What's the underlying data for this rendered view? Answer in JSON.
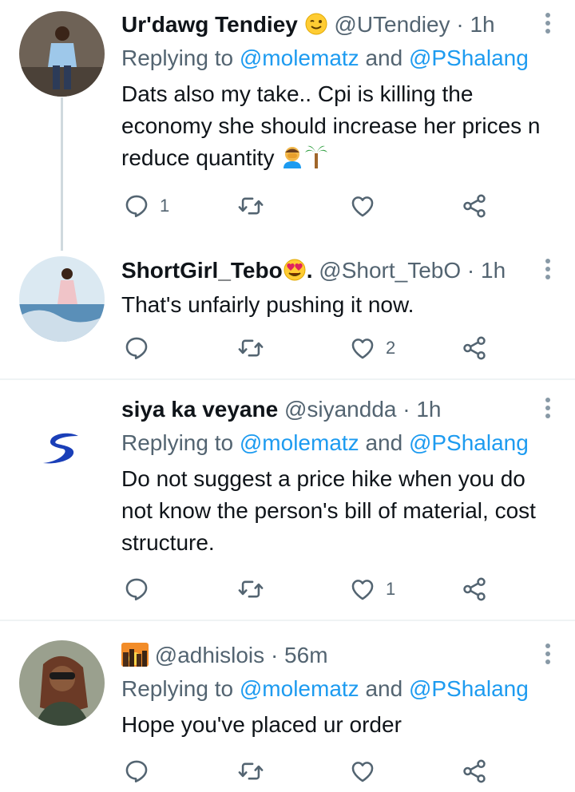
{
  "tweets": [
    {
      "name": "Ur'dawg Tendiey",
      "handle": "@UTendiey",
      "time": "1h",
      "replying_prefix": "Replying to",
      "replying_users": [
        "@molematz",
        "@PShalang"
      ],
      "replying_joiner": "and",
      "text": "Dats also my take.. Cpi is killing the economy she should increase her prices n reduce quantity",
      "emojis": [
        "facepalm-emoji",
        "palm-tree-emoji"
      ],
      "reply_count": "1",
      "retweet_count": "",
      "like_count": ""
    },
    {
      "name": "ShortGirl_Tebo",
      "name_suffix": ".",
      "handle": "@Short_TebO",
      "time": "1h",
      "text": "That's unfairly pushing it now.",
      "reply_count": "",
      "retweet_count": "",
      "like_count": "2"
    },
    {
      "name": "siya ka veyane",
      "handle": "@siyandda",
      "time": "1h",
      "replying_prefix": "Replying to",
      "replying_users": [
        "@molematz",
        "@PShalang"
      ],
      "replying_joiner": "and",
      "text": "Do not suggest a price hike when you do not know the person's bill of material, cost structure.",
      "reply_count": "",
      "retweet_count": "",
      "like_count": "1"
    },
    {
      "name": "",
      "handle": "@adhislois",
      "time": "56m",
      "replying_prefix": "Replying to",
      "replying_users": [
        "@molematz",
        "@PShalang"
      ],
      "replying_joiner": "and",
      "text": "Hope you've placed ur order",
      "reply_count": "",
      "retweet_count": "",
      "like_count": ""
    }
  ],
  "separator": "·",
  "colors": {
    "link": "#1d9bf0",
    "muted": "#536471",
    "text": "#0f1419",
    "divider": "#eff3f4"
  }
}
